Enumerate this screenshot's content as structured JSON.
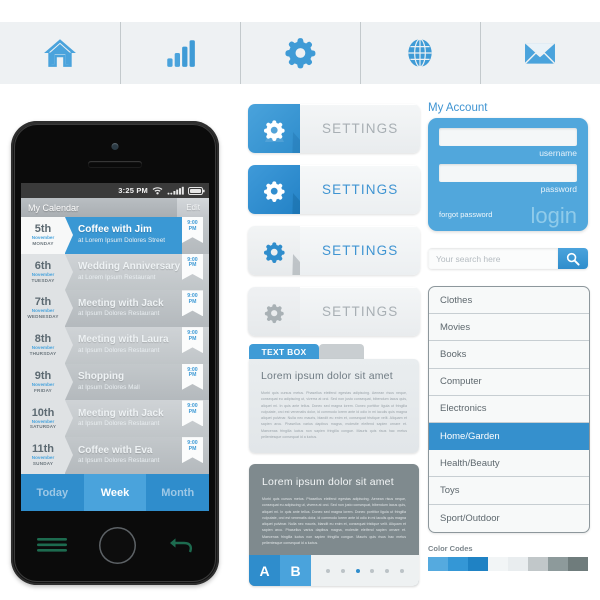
{
  "toolbar": {
    "items": [
      {
        "icon": "home-icon",
        "name": "toolbar-item-home"
      },
      {
        "icon": "signal-bars-icon",
        "name": "toolbar-item-stats"
      },
      {
        "icon": "gear-icon",
        "name": "toolbar-item-settings"
      },
      {
        "icon": "globe-icon",
        "name": "toolbar-item-web"
      },
      {
        "icon": "envelope-icon",
        "name": "toolbar-item-mail"
      }
    ]
  },
  "phone": {
    "status": {
      "time": "3:25 PM",
      "wifi": "wifi-icon",
      "signal": "signal-icon",
      "battery": "battery-icon"
    },
    "header": {
      "title": "My Calendar",
      "edit_label": "Edit"
    },
    "events": [
      {
        "day": "5th",
        "month": "November",
        "weekday": "MONDAY",
        "title": "Coffee with Jim",
        "location": "at Lorem Ipsum Dolores Street",
        "time_top": "9:00",
        "time_bottom": "PM",
        "selected": true
      },
      {
        "day": "6th",
        "month": "November",
        "weekday": "TUESDAY",
        "title": "Wedding Anniversary",
        "location": "at Lorem Ipsum Restaurant",
        "time_top": "9:00",
        "time_bottom": "PM",
        "selected": false
      },
      {
        "day": "7th",
        "month": "November",
        "weekday": "WEDNESDAY",
        "title": "Meeting with Jack",
        "location": "at Ipsum Dolores Restaurant",
        "time_top": "9:00",
        "time_bottom": "PM",
        "selected": false
      },
      {
        "day": "8th",
        "month": "November",
        "weekday": "THURSDAY",
        "title": "Meeting with Laura",
        "location": "at Ipsum Dolores Restaurant",
        "time_top": "9:00",
        "time_bottom": "PM",
        "selected": false
      },
      {
        "day": "9th",
        "month": "November",
        "weekday": "FRIDAY",
        "title": "Shopping",
        "location": "at Ipsum Dolores Mall",
        "time_top": "9:00",
        "time_bottom": "PM",
        "selected": false
      },
      {
        "day": "10th",
        "month": "November",
        "weekday": "SATURDAY",
        "title": "Meeting with Jack",
        "location": "at Ipsum Dolores Restaurant",
        "time_top": "9:00",
        "time_bottom": "PM",
        "selected": false
      },
      {
        "day": "11th",
        "month": "November",
        "weekday": "SUNDAY",
        "title": "Coffee with Eva",
        "location": "at Ipsum Dolores Restaurant",
        "time_top": "9:00",
        "time_bottom": "PM",
        "selected": false
      }
    ],
    "tabs": [
      {
        "label": "Today",
        "active": false
      },
      {
        "label": "Week",
        "active": true
      },
      {
        "label": "Month",
        "active": false
      }
    ],
    "hardware": {
      "menu": "menu-lines-icon",
      "home": "home-button",
      "back": "back-arrow-icon"
    }
  },
  "settings_buttons": [
    {
      "label": "SETTINGS",
      "icon": "gear-icon",
      "state": "blue-default"
    },
    {
      "label": "SETTINGS",
      "icon": "gear-icon",
      "state": "blue-active"
    },
    {
      "label": "SETTINGS",
      "icon": "gear-icon",
      "state": "light-active"
    },
    {
      "label": "SETTINGS",
      "icon": "gear-icon",
      "state": "light-disabled"
    }
  ],
  "text_box": {
    "tab_active": "TEXT BOX",
    "tab_inactive": "",
    "heading": "Lorem ipsum dolor sit amet",
    "body": "Morbi quis cursus metus. Phasellus eleifend egestas adipiscing. Aenean risus neque, consequat eu adipiscing ut, viverra at orci. Sed non justo consequat, bibendum lacus quis, aliquet mi. In quis ante tellus. Donec sed magna lorem. Donec porttitor ligula ut fringilla vulputate, orci est venenatis dolor, id commodo lorem ante id odio in mi iaculis quis magna aliquet pulvinar. Nulla nec mauris, blandit eu enim et, consequat tristique velit. Aliquam et sapien arcu. Phasellus varius dapibus magna, molestie eleifend sapien ornare et. Maecenas fringilla luctus non sapien fringilla congue. Mauris quis risus hac metus pellentesque consequat id a luctus."
  },
  "dark_card": {
    "heading": "Lorem ipsum dolor sit amet",
    "body": "Morbi quis cursus metus. Phasellus eleifend egestas adipiscing. Aenean risus neque, consequat eu adipiscing ut, viverra at orci. Sed non justo consequat, bibendum lacus quis, aliquet mi. In quis ante tellus. Donec sed magna lorem. Donec porttitor ligula ut fringilla vulputate, orci est venenatis dolor, id commodo lorem ante id odio in mi iaculis quis magna aliquet pulvinar. Nulla nec mauris, blandit eu enim et, consequat tristique velit. Aliquam et sapien arcu. Phasellus varius dapibus magna, molestie eleifend sapien ornare et. Maecenas fringilla luctus non sapien fringilla congue. Mauris quis risus hac metus pellentesque consequat id a luctus.",
    "button_a": "A",
    "button_b": "B",
    "dots": {
      "count": 6,
      "active_index": 2
    }
  },
  "account": {
    "title": "My Account",
    "username": {
      "value": "",
      "label": "username"
    },
    "password": {
      "value": "",
      "label": "password"
    },
    "forgot_label": "forgot password",
    "login_label": "login"
  },
  "search": {
    "placeholder": "Your search here",
    "value": "",
    "icon": "search-icon"
  },
  "categories": [
    {
      "label": "Clothes",
      "selected": false
    },
    {
      "label": "Movies",
      "selected": false
    },
    {
      "label": "Books",
      "selected": false
    },
    {
      "label": "Computer",
      "selected": false
    },
    {
      "label": "Electronics",
      "selected": false
    },
    {
      "label": "Home/Garden",
      "selected": true
    },
    {
      "label": "Health/Beauty",
      "selected": false
    },
    {
      "label": "Toys",
      "selected": false
    },
    {
      "label": "Sport/Outdoor",
      "selected": false
    }
  ],
  "color_codes": {
    "title": "Color Codes",
    "swatches": [
      "#55aadf",
      "#3497d6",
      "#1f82c4",
      "#f2f5f6",
      "#e9edef",
      "#c1c7c9",
      "#8d9a9b",
      "#6f7c7c"
    ]
  },
  "accent": {
    "blue": "#3f9bd6",
    "blue_dark": "#2382c6",
    "gray": "#7f8a8e",
    "canvas": "#ffffff",
    "toolbar_bg": "#eef1f3"
  }
}
